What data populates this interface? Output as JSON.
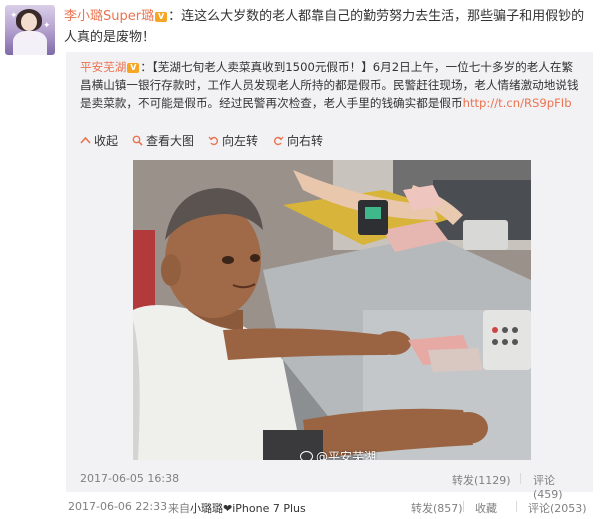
{
  "post": {
    "username": "李小璐Super璐",
    "text": "：连这么大岁数的老人都靠自己的勤劳努力去生活，那些骗子和用假钞的人真的是废物！"
  },
  "repost": {
    "username": "平安芜湖",
    "text": "：【芜湖七旬老人卖菜真收到1500元假币！】6月2日上午，一位七十多岁的老人在繁昌横山镇一银行存款时，工作人员发现老人所持的都是假币。民警赶往现场，老人情绪激动地说钱是卖菜款，不可能是假币。经过民警再次检查，老人手里的钱确实都是假币",
    "link": "http://t.cn/RS9pFIb",
    "toolbar": {
      "collect": "收起",
      "view_large": "查看大图",
      "rotate_left": "向左转",
      "rotate_right": "向右转"
    },
    "watermark": "@平安芜湖",
    "time": "2017-06-05 16:38",
    "forward": "转发(1129)",
    "comment": "评论(459)"
  },
  "footer": {
    "time": "2017-06-06 22:33",
    "source_prefix": "来自",
    "source_device": "小璐璐❤iPhone 7 Plus",
    "forward": "转发(857)",
    "favorite": "收藏",
    "comment": "评论(2053)"
  },
  "colors": {
    "accent": "#eb7350",
    "repost_bg": "#f2f2f5",
    "meta_text": "#808080"
  }
}
